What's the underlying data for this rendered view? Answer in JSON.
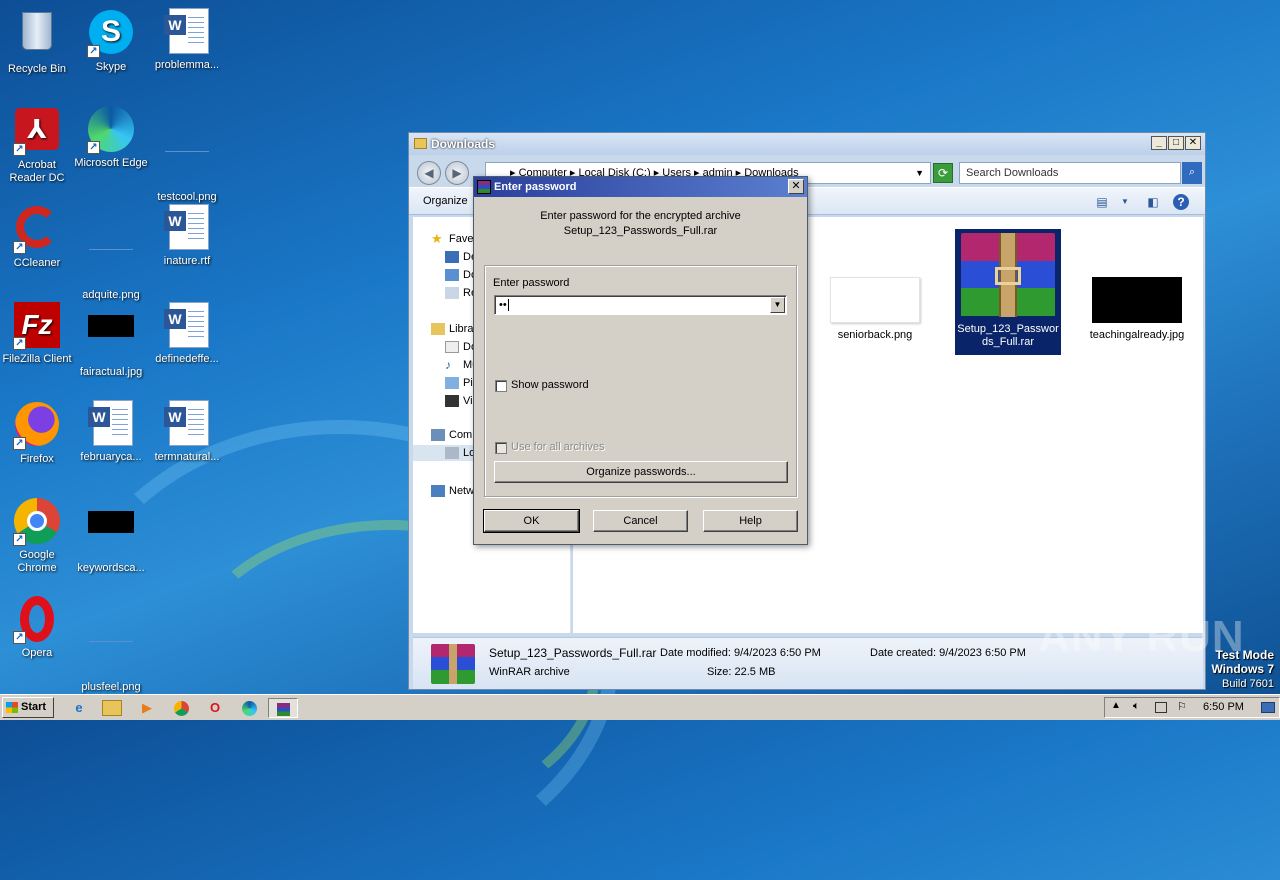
{
  "desktop": {
    "icons": [
      {
        "label": "Recycle Bin"
      },
      {
        "label": "Skype"
      },
      {
        "label": "problemma..."
      },
      {
        "label": "Acrobat Reader DC"
      },
      {
        "label": "Microsoft Edge"
      },
      {
        "label": "testcool.png"
      },
      {
        "label": "CCleaner"
      },
      {
        "label": "adquite.png"
      },
      {
        "label": "inature.rtf"
      },
      {
        "label": "FileZilla Client"
      },
      {
        "label": "fairactual.jpg"
      },
      {
        "label": "definedeffe..."
      },
      {
        "label": "Firefox"
      },
      {
        "label": "februaryca..."
      },
      {
        "label": "termnatural..."
      },
      {
        "label": "Google Chrome"
      },
      {
        "label": "keywordsca..."
      },
      {
        "label": "Opera"
      },
      {
        "label": "plusfeel.png"
      }
    ],
    "watermark": "ANY RUN",
    "test_mode": {
      "line1": "Test Mode",
      "line2": "Windows 7",
      "line3": "Build 7601"
    }
  },
  "explorer": {
    "title": "Downloads",
    "address": "▸ Computer ▸ Local Disk (C:) ▸ Users ▸ admin ▸ Downloads",
    "search_placeholder": "Search Downloads",
    "organize_label": "Organize",
    "nav": {
      "favorites": "Fave",
      "fav_items": [
        "De",
        "Do",
        "Re"
      ],
      "libraries": "Libra",
      "lib_items": [
        "Do",
        "Mu",
        "Pic",
        "Vi"
      ],
      "computer": "Com",
      "computer_items": [
        "Lo"
      ],
      "network": "Netw"
    },
    "files": [
      {
        "name": "seniorback.png"
      },
      {
        "name": "Setup_123_Passwords_Full.rar"
      },
      {
        "name": "teachingalready.jpg"
      }
    ],
    "details": {
      "filename": "Setup_123_Passwords_Full.rar",
      "type": "WinRAR archive",
      "modified_label": "Date modified: 9/4/2023 6:50 PM",
      "size_label": "Size: 22.5 MB",
      "created_label": "Date created: 9/4/2023 6:50 PM"
    }
  },
  "dialog": {
    "title": "Enter password",
    "message_line1": "Enter password for the encrypted archive",
    "message_line2": "Setup_123_Passwords_Full.rar",
    "password_label": "Enter password",
    "password_value": "••",
    "show_password": "Show password",
    "use_all_archives": "Use for all archives",
    "organize_button": "Organize passwords...",
    "ok_button": "OK",
    "cancel_button": "Cancel",
    "help_button": "Help"
  },
  "taskbar": {
    "start_label": "Start",
    "clock": "6:50 PM"
  },
  "colors": {
    "desktop_blue": "#1a78c8",
    "dialog_title": "#2b3f9b",
    "selection": "#0a246a"
  }
}
